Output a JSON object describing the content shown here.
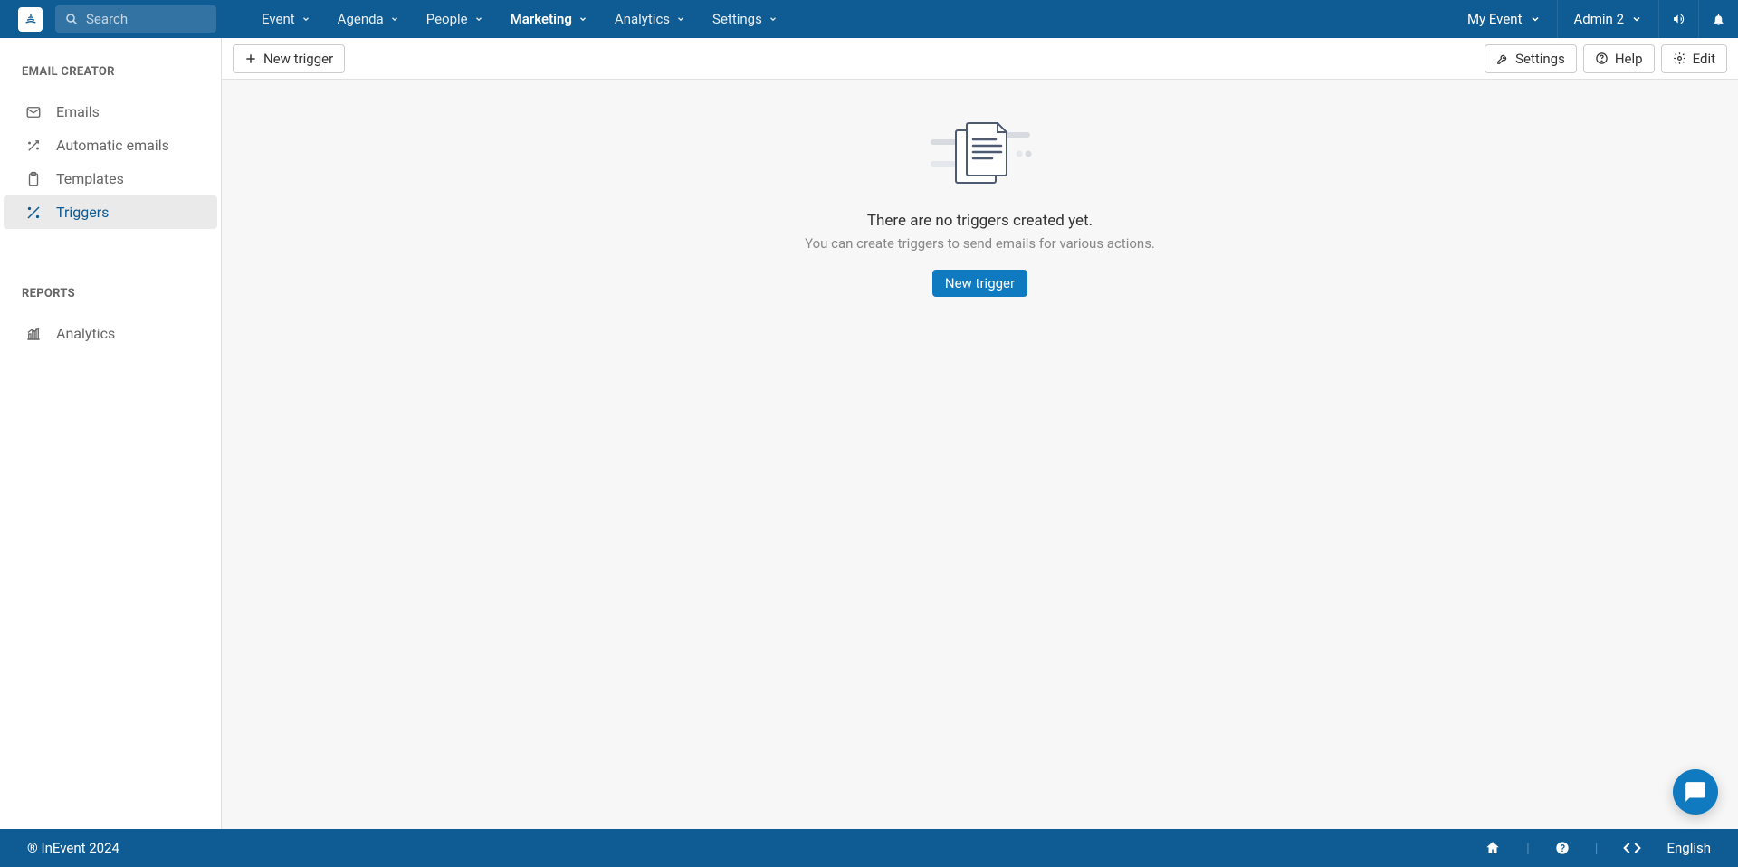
{
  "search": {
    "placeholder": "Search"
  },
  "topnav": {
    "event": "Event",
    "agenda": "Agenda",
    "people": "People",
    "marketing": "Marketing",
    "analytics": "Analytics",
    "settings": "Settings"
  },
  "topright": {
    "myevent": "My Event",
    "admin": "Admin 2"
  },
  "sidebar": {
    "section1": "EMAIL CREATOR",
    "emails": "Emails",
    "automatic": "Automatic emails",
    "templates": "Templates",
    "triggers": "Triggers",
    "section2": "REPORTS",
    "analytics": "Analytics"
  },
  "toolbar": {
    "newtrigger": "New trigger",
    "settings": "Settings",
    "help": "Help",
    "edit": "Edit"
  },
  "empty": {
    "title": "There are no triggers created yet.",
    "sub": "You can create triggers to send emails for various actions.",
    "cta": "New trigger"
  },
  "footer": {
    "copyright": "® InEvent 2024",
    "language": "English"
  }
}
